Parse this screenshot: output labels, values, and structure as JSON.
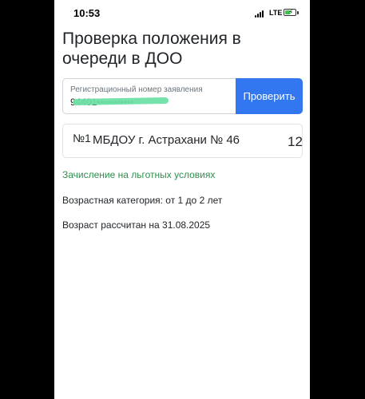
{
  "status_bar": {
    "time": "10:53",
    "network": "LTE",
    "battery_level": 0.5
  },
  "header": {
    "title": "Проверка положения в очереди в ДОО"
  },
  "search": {
    "label": "Регистрационный номер заявления",
    "value": "94401•••••••••••",
    "button_label": "Проверить"
  },
  "result": {
    "number": "№1",
    "organization": "МБДОУ г. Астрахани № 46",
    "queue_position": "12"
  },
  "details": {
    "priority_link": "Зачисление на льготных условиях",
    "age_category": "Возрастная категория: от 1 до 2 лет",
    "age_calculated": "Возраст рассчитан на 31.08.2025"
  },
  "colors": {
    "accent": "#3377f0",
    "link_green": "#2f8f4e",
    "redaction": "#6fe0a7"
  }
}
